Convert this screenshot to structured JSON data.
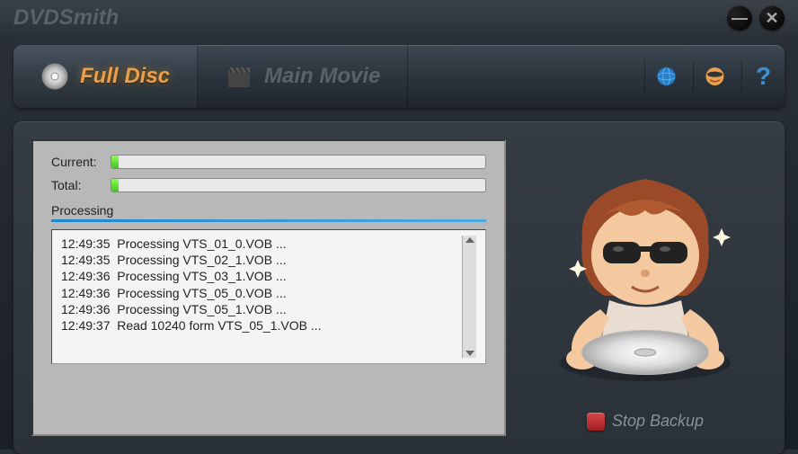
{
  "app": {
    "title": "DVDSmith"
  },
  "window": {
    "minimize": "—",
    "close": "✕"
  },
  "tabs": {
    "full_disc": "Full Disc",
    "main_movie": "Main Movie"
  },
  "tools": {
    "globe": "globe-icon",
    "chat": "chat-icon",
    "help": "?"
  },
  "progress": {
    "current_label": "Current:",
    "total_label": "Total:",
    "current_pct": 2,
    "total_pct": 2,
    "processing_label": "Processing"
  },
  "log": [
    "12:49:35  Processing VTS_01_0.VOB ...",
    "12:49:35  Processing VTS_02_1.VOB ...",
    "12:49:36  Processing VTS_03_1.VOB ...",
    "12:49:36  Processing VTS_05_0.VOB ...",
    "12:49:36  Processing VTS_05_1.VOB ...",
    "12:49:37  Read 10240 form VTS_05_1.VOB ..."
  ],
  "stop": {
    "label": "Stop Backup"
  }
}
